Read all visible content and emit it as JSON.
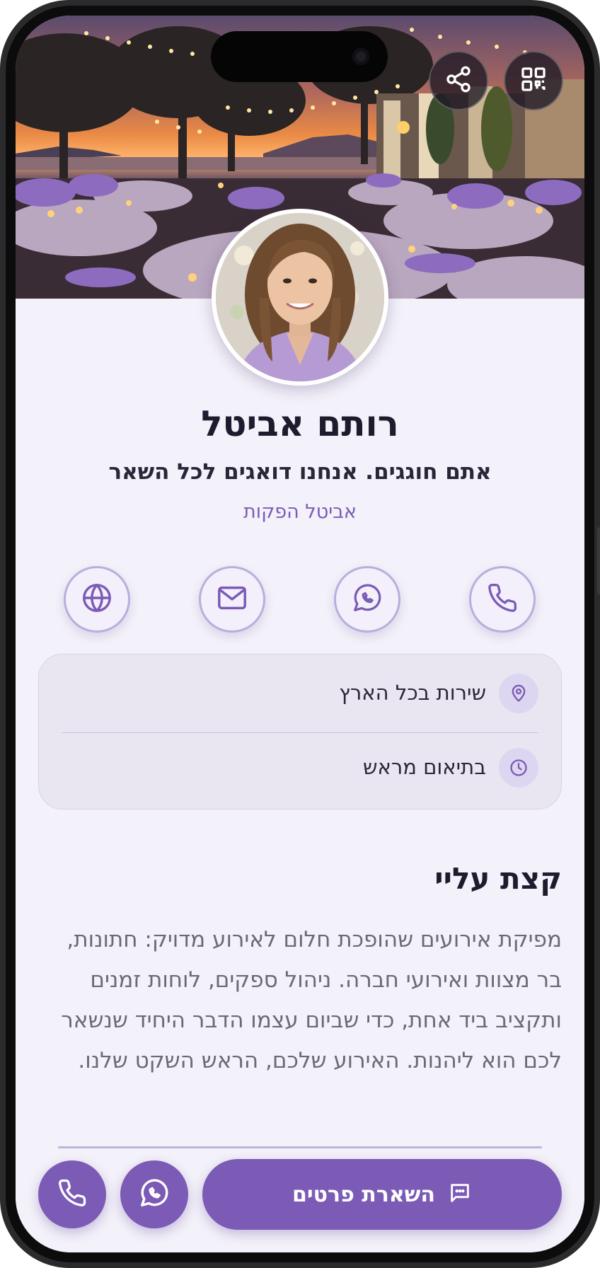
{
  "profile": {
    "name": "רותם אביטל",
    "tagline": "אתם חוגגים. אנחנו דואגים לכל השאר",
    "company": "אביטל הפקות"
  },
  "header_buttons": {
    "share_icon": "share-icon",
    "qr_icon": "qr-code-icon"
  },
  "contact_actions": [
    {
      "icon": "phone-icon"
    },
    {
      "icon": "whatsapp-icon"
    },
    {
      "icon": "mail-icon"
    },
    {
      "icon": "globe-icon"
    }
  ],
  "info": {
    "location": "שירות בכל הארץ",
    "hours": "בתיאום מראש"
  },
  "about": {
    "title": "קצת עליי",
    "text": "מפיקת אירועים שהופכת חלום לאירוע מדויק: חתונות, בר מצוות ואירועי חברה. ניהול ספקים, לוחות זמנים ותקציב ביד אחת, כדי שביום עצמו הדבר היחיד שנשאר לכם הוא ליהנות. האירוע שלכם, הראש השקט שלנו."
  },
  "bottom_bar": {
    "cta_label": "השארת פרטים",
    "cta_icon": "message-icon"
  },
  "colors": {
    "accent": "#7b5bb5",
    "background": "#f3f1f9",
    "text_dark": "#1e1b2e"
  }
}
